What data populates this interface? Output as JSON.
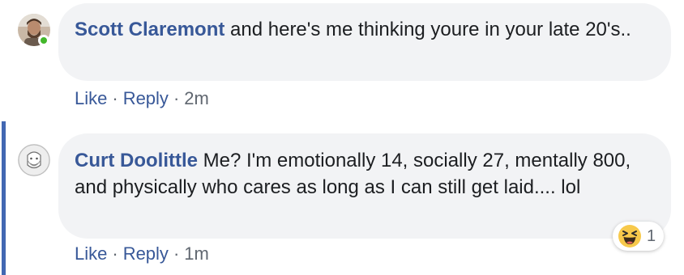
{
  "comments": [
    {
      "author": "Scott Claremont",
      "text": "and here's me thinking youre in your late 20's..",
      "online": true,
      "actions": {
        "like": "Like",
        "reply": "Reply",
        "separator": "·",
        "time": "2m"
      }
    },
    {
      "author": "Curt Doolittle",
      "text": "Me? I'm emotionally 14, socially 27, mentally 800, and physically who cares as long as I can still get laid.... lol",
      "actions": {
        "like": "Like",
        "reply": "Reply",
        "separator": "·",
        "time": "1m"
      },
      "reactions": {
        "icon": "haha-emoji-icon",
        "count": "1"
      }
    }
  ],
  "colors": {
    "link": "#385898",
    "bubble": "#f2f3f5",
    "thread_accent": "#4267b2",
    "online": "#42b72a"
  }
}
